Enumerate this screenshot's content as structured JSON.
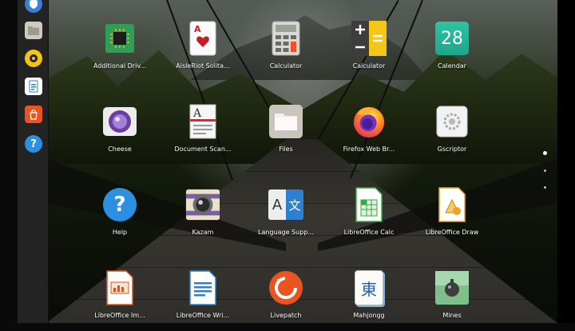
{
  "dock": {
    "items": [
      {
        "name": "security-app",
        "icon": "shield-icon",
        "color": "#3b7fd9"
      },
      {
        "name": "files",
        "icon": "folder-icon",
        "color": "#c7c3b9"
      },
      {
        "name": "rhythmbox",
        "icon": "speaker-icon",
        "color": "#f0c419"
      },
      {
        "name": "writer",
        "icon": "document-icon",
        "color": "#2f7fd1"
      },
      {
        "name": "software",
        "icon": "shopping-bag-icon",
        "color": "#e95420"
      },
      {
        "name": "help",
        "icon": "help-icon",
        "color": "#2d8fe0"
      }
    ]
  },
  "apps": [
    {
      "label": "Additional Driv...",
      "icon": "chip-icon"
    },
    {
      "label": "AisleRiot Solita...",
      "icon": "playing-card-icon"
    },
    {
      "label": "Calculator",
      "icon": "calculator-icon"
    },
    {
      "label": "Calculator",
      "icon": "calculator-icon"
    },
    {
      "label": "Calendar",
      "icon": "calendar-icon",
      "day": "28"
    },
    {
      "label": "Cheese",
      "icon": "webcam-icon"
    },
    {
      "label": "Document Scan...",
      "icon": "scanner-icon"
    },
    {
      "label": "Files",
      "icon": "folder-icon"
    },
    {
      "label": "Firefox Web Br...",
      "icon": "firefox-icon"
    },
    {
      "label": "Gscriptor",
      "icon": "gear-icon"
    },
    {
      "label": "Help",
      "icon": "help-icon",
      "glyph": "?"
    },
    {
      "label": "Kazam",
      "icon": "camera-lens-icon"
    },
    {
      "label": "Language Supp...",
      "icon": "language-icon",
      "glyph_a": "A",
      "glyph_b": "文"
    },
    {
      "label": "LibreOffice Calc",
      "icon": "spreadsheet-icon"
    },
    {
      "label": "LibreOffice Draw",
      "icon": "drawing-icon"
    },
    {
      "label": "LibreOffice Im...",
      "icon": "presentation-icon"
    },
    {
      "label": "LibreOffice Wri...",
      "icon": "writer-document-icon"
    },
    {
      "label": "Livepatch",
      "icon": "livepatch-icon"
    },
    {
      "label": "Mahjongg",
      "icon": "mahjongg-tile-icon",
      "glyph": "東"
    },
    {
      "label": "Mines",
      "icon": "mines-icon"
    }
  ],
  "page_indicator": {
    "pages": 3,
    "current": 1
  }
}
